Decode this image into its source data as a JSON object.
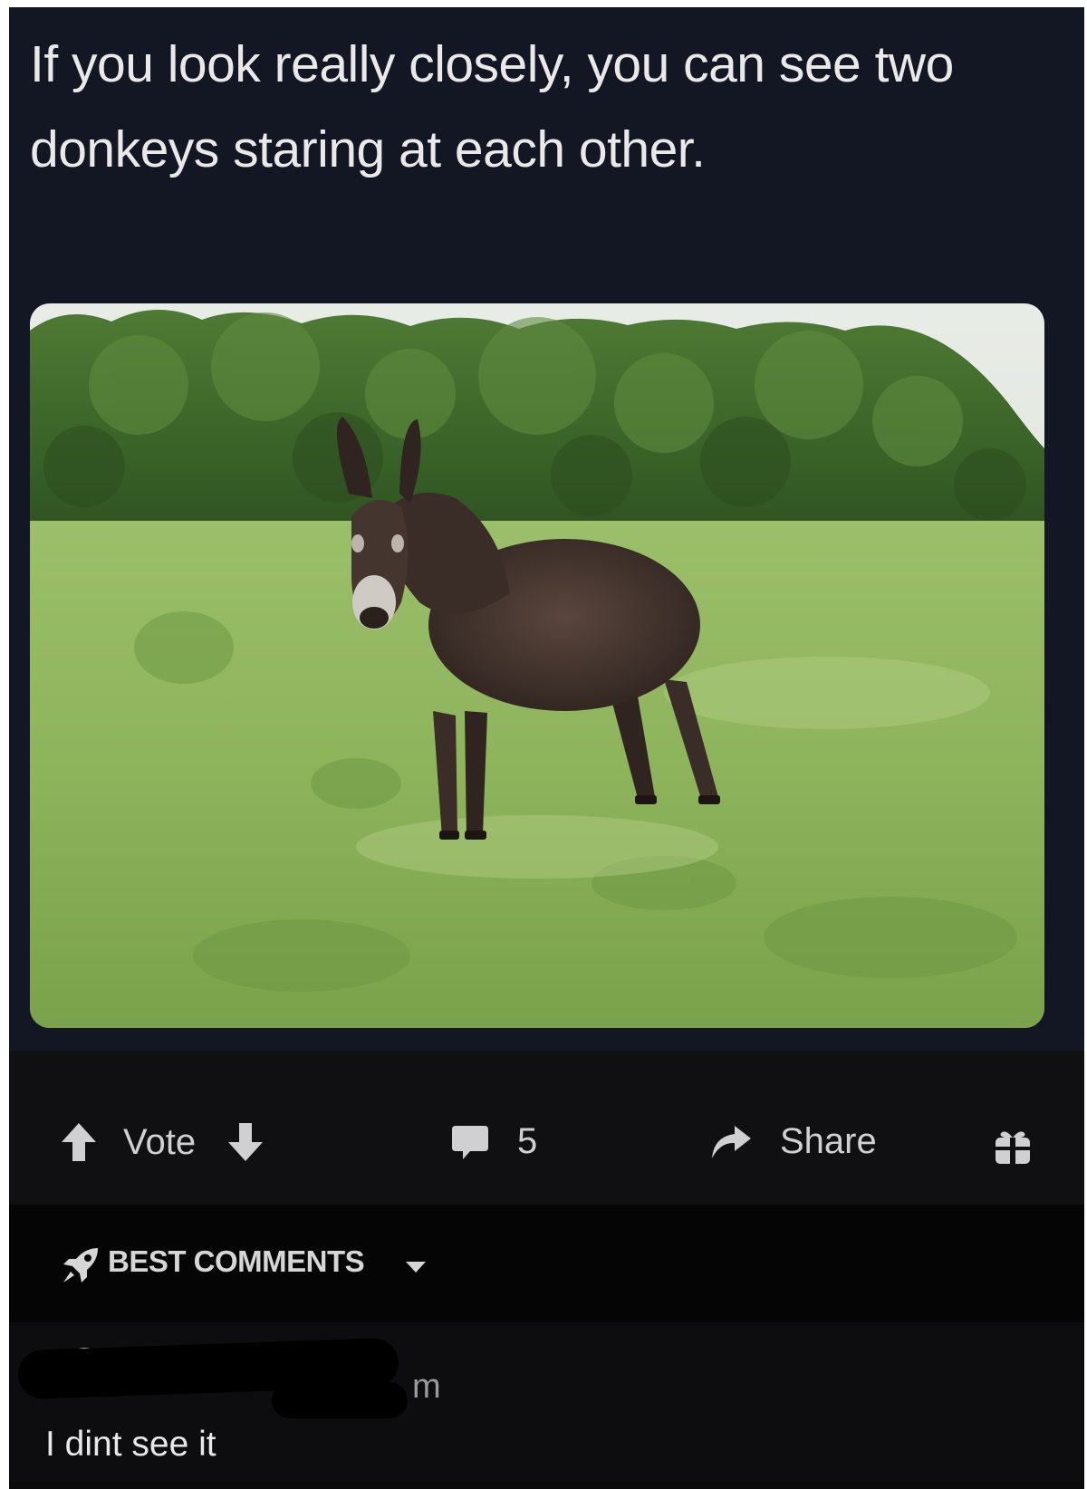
{
  "post": {
    "title": "If you look really closely, you can see two donkeys staring at each other."
  },
  "actions": {
    "vote_label": "Vote",
    "comment_count": "5",
    "share_label": "Share",
    "icons": [
      "upvote-arrow-icon",
      "downvote-arrow-icon",
      "comment-bubble-icon",
      "share-arrow-icon",
      "gift-icon"
    ]
  },
  "comments_sort": {
    "label": "BEST COMMENTS",
    "icons": [
      "rocket-icon",
      "caret-down-icon"
    ]
  },
  "comment": {
    "time_fragment": "m",
    "text": "I dint see it"
  },
  "colors": {
    "post_background": "#121723",
    "action_bar": "#101012",
    "sort_bar": "#050505",
    "text": "#e9e9ea"
  }
}
